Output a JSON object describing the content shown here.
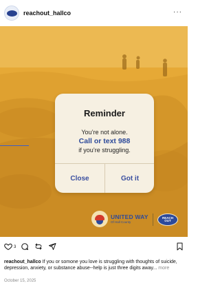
{
  "post": {
    "username": "reachout_hallco",
    "more_label": "···"
  },
  "card": {
    "title": "Reminder",
    "line1": "You’re not alone.",
    "line2": "Call or text 988",
    "line3": "if you’re struggling.",
    "close_label": "Close",
    "gotit_label": "Got it"
  },
  "logos": {
    "uw_name": "UNITED WAY",
    "uw_sub": "Of Hall County",
    "badge_line1": "REACH",
    "badge_line2": "OUT"
  },
  "actions": {
    "like_count": "3"
  },
  "caption": {
    "user": "reachout_hallco",
    "text": " If you or somone you love is struggling with thoughts of suicide, depression, anxiety, or substance abuse--help is just three digits away...",
    "more": " more"
  },
  "date": "October 15, 2025",
  "colors": {
    "overlay_yellow": "#e9ad38",
    "brand_blue": "#2d4a9a",
    "card_bg": "#f6f0e2"
  }
}
